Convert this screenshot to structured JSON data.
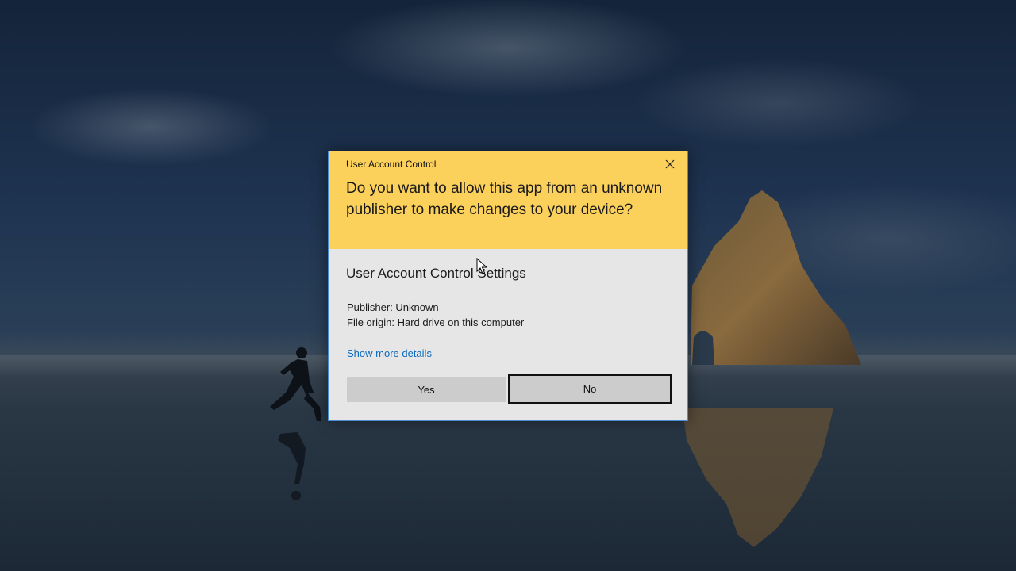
{
  "dialog": {
    "title": "User Account Control",
    "question": "Do you want to allow this app from an unknown publisher to make changes to your device?",
    "app_name": "User Account Control Settings",
    "publisher": "Publisher: Unknown",
    "file_origin": "File origin: Hard drive on this computer",
    "details_link": "Show more details",
    "yes_label": "Yes",
    "no_label": "No",
    "close_icon": "close-icon"
  },
  "colors": {
    "header_background": "#fcd15b",
    "body_background": "#e6e6e6",
    "link": "#0b6bbf",
    "button": "#cccccc",
    "border_accent": "#4a8fd6"
  }
}
